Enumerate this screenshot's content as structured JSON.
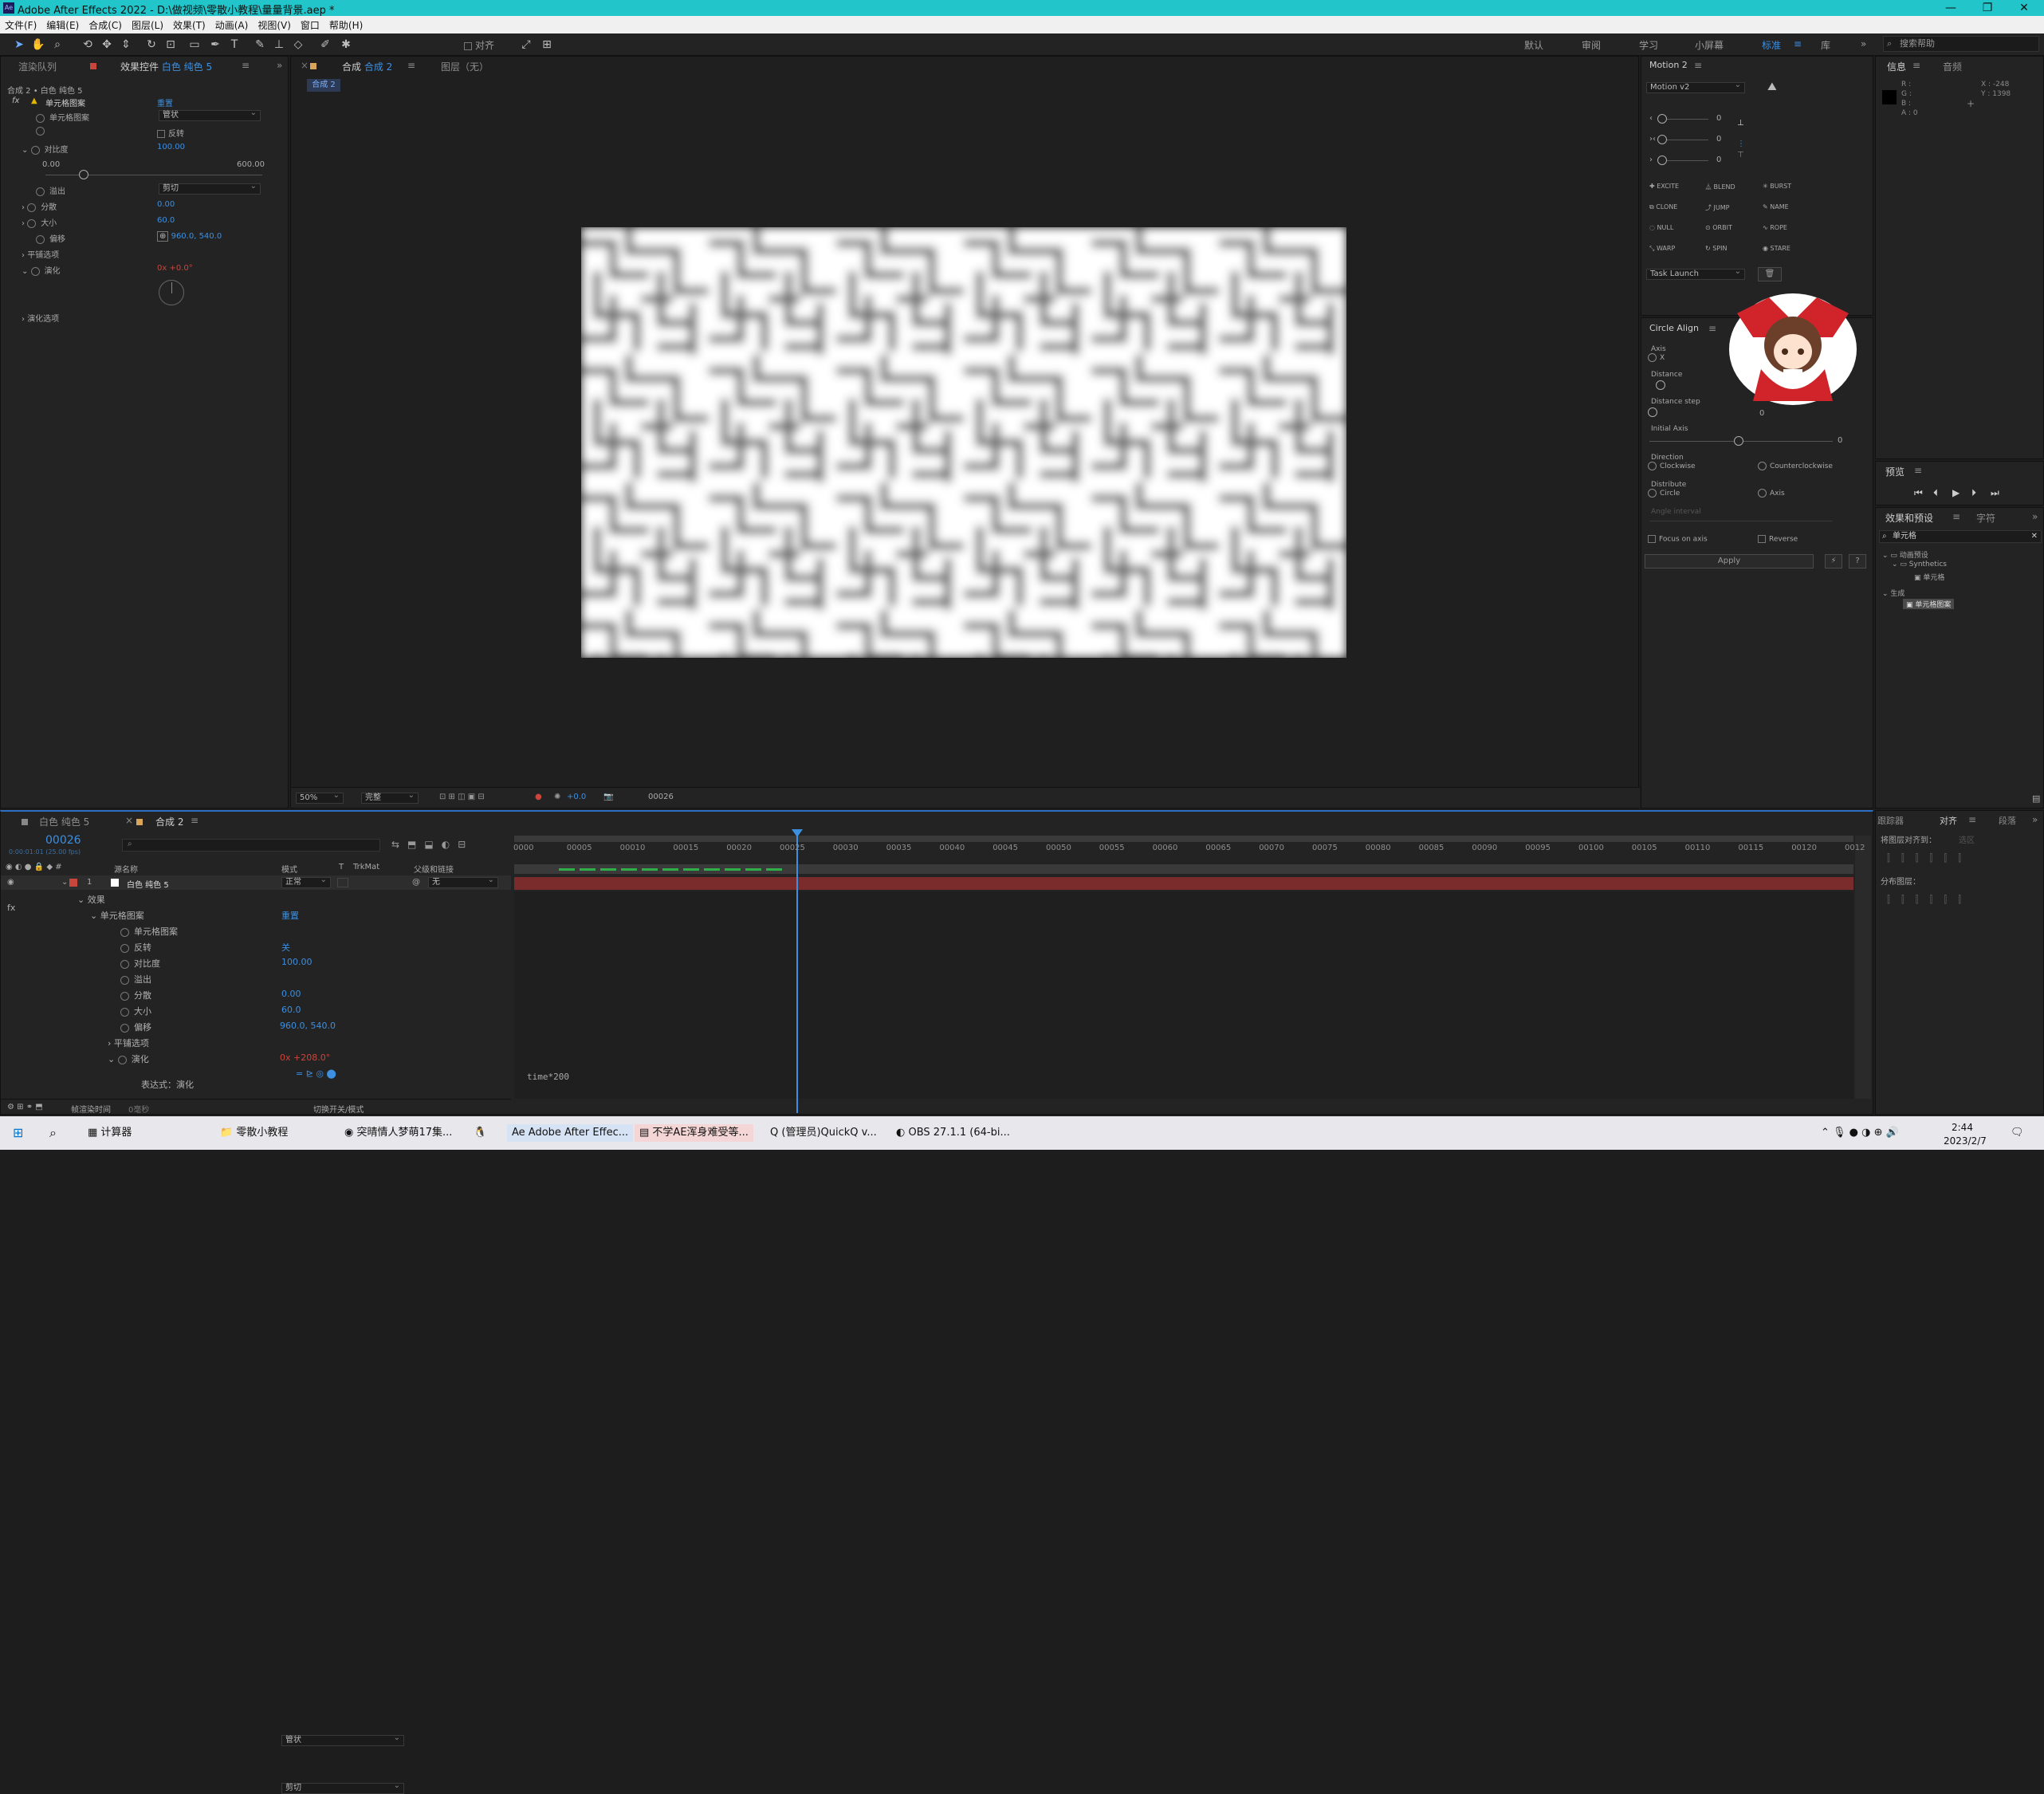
{
  "app": {
    "title": "Adobe After Effects 2022 - D:\\做视频\\零散小教程\\量量背景.aep *"
  },
  "menu": [
    "文件(F)",
    "编辑(E)",
    "合成(C)",
    "图层(L)",
    "效果(T)",
    "动画(A)",
    "视图(V)",
    "窗口",
    "帮助(H)"
  ],
  "toolbar": {
    "align_label": "对齐",
    "workspaces": [
      "默认",
      "审阅",
      "学习",
      "小屏幕",
      "标准",
      "库"
    ],
    "active_workspace": "标准",
    "search_placeholder": "搜索帮助"
  },
  "effect_panel": {
    "tab_render": "渲染队列",
    "tab_effects": "效果控件",
    "layer": "白色 纯色 5",
    "breadcrumb": "合成 2 • 白色 纯色 5",
    "effect_name": "单元格图案",
    "reset": "重置",
    "props": [
      {
        "name": "单元格图案",
        "value": "管状"
      },
      {
        "name": "反转",
        "value": ""
      },
      {
        "name": "对比度",
        "value": "100.00"
      },
      {
        "name": "",
        "value": "0.00",
        "value2": "600.00"
      },
      {
        "name": "溢出",
        "value": "剪切"
      },
      {
        "name": "分散",
        "value": "0.00"
      },
      {
        "name": "大小",
        "value": "60.0"
      },
      {
        "name": "偏移",
        "value": "960.0, 540.0"
      },
      {
        "name": "平铺选项",
        "value": ""
      },
      {
        "name": "演化",
        "value": "0x +0.0°"
      },
      {
        "name": "演化选项",
        "value": ""
      }
    ],
    "invert_label": "反转"
  },
  "comp": {
    "tab_label": "合成",
    "comp_name": "合成 2",
    "layer_tab": "图层（无）",
    "sub_tab": "合成 2",
    "zoom": "50%",
    "quality": "完整",
    "exposure": "+0.0",
    "timecode": "00026"
  },
  "motion": {
    "title": "Motion 2",
    "preset": "Motion v2",
    "rows": [
      "0",
      "0",
      "0"
    ],
    "buttons": [
      "EXCITE",
      "BLEND",
      "BURST",
      "CLONE",
      "JUMP",
      "NAME",
      "NULL",
      "ORBIT",
      "ROPE",
      "WARP",
      "SPIN",
      "STARE"
    ],
    "task": "Task Launch"
  },
  "circle_align": {
    "title": "Circle Align",
    "axis": "Axis",
    "axis_x": "X",
    "distance": "Distance",
    "distance_step": "Distance step",
    "distance_step_val": "0",
    "initial_axis": "Initial Axis",
    "initial_axis_val": "0",
    "direction": "Direction",
    "clockwise": "Clockwise",
    "counterclockwise": "Counterclockwise",
    "distribute": "Distribute",
    "circle": "Circle",
    "axis_opt": "Axis",
    "angle_interval": "Angle interval",
    "focus": "Focus on axis",
    "reverse": "Reverse",
    "apply": "Apply"
  },
  "info": {
    "tab_info": "信息",
    "tab_audio": "音频",
    "r": "R :",
    "g": "G :",
    "b": "B :",
    "a": "A : 0",
    "x": "X : -248",
    "y": "Y : 1398"
  },
  "preview": {
    "title": "预览"
  },
  "effects_presets": {
    "tab": "效果和预设",
    "tab2": "字符",
    "search": "单元格",
    "tree": [
      {
        "label": "动画预设",
        "level": 0
      },
      {
        "label": "Synthetics",
        "level": 1
      },
      {
        "label": "单元格",
        "level": 2
      },
      {
        "label": "生成",
        "level": 0
      },
      {
        "label": "单元格图案",
        "level": 1
      }
    ]
  },
  "align": {
    "tab_align": "对齐",
    "tab_para": "段落",
    "tab_tracker": "跟踪器",
    "align_to": "将图层对齐到：",
    "align_to_val": "选区",
    "distribute": "分布图层："
  },
  "timeline": {
    "tabs": [
      "白色 纯色 5",
      "合成 2"
    ],
    "timecode": "00026",
    "fps": "0:00:01:01 (25.00 fps)",
    "columns": {
      "source": "源名称",
      "mode": "模式",
      "t": "T",
      "trkmat": "TrkMat",
      "parent": "父级和链接"
    },
    "layer": {
      "num": "1",
      "name": "白色 纯色 5",
      "mode": "正常",
      "parent": "无"
    },
    "rows": [
      {
        "name": "效果",
        "value": ""
      },
      {
        "name": "单元格图案",
        "value": "重置"
      },
      {
        "name": "单元格图案",
        "value": "管状"
      },
      {
        "name": "反转",
        "value": "关"
      },
      {
        "name": "对比度",
        "value": "100.00"
      },
      {
        "name": "溢出",
        "value": "剪切"
      },
      {
        "name": "分散",
        "value": "0.00"
      },
      {
        "name": "大小",
        "value": "60.0"
      },
      {
        "name": "偏移",
        "value": "960.0, 540.0"
      },
      {
        "name": "平铺选项",
        "value": ""
      },
      {
        "name": "演化",
        "value": "0x +208.0°"
      },
      {
        "name": "表达式：演化",
        "value": ""
      }
    ],
    "expression": "time*200",
    "ticks": [
      "0000",
      "00005",
      "00010",
      "00015",
      "00020",
      "00025",
      "00030",
      "00035",
      "00040",
      "00045",
      "00050",
      "00055",
      "00060",
      "00065",
      "00070",
      "00075",
      "00080",
      "00085",
      "00090",
      "00095",
      "00100",
      "00105",
      "00110",
      "00115",
      "00120",
      "0012"
    ],
    "footer_left": "帧渲染时间",
    "footer_val": "0毫秒",
    "footer_mid": "切换开关/模式"
  },
  "taskbar": {
    "apps": [
      "计算器",
      "零散小教程",
      "突晴情人梦萌17集...",
      "Adobe After Effec...",
      "不学AE浑身难受等...",
      "(管理员)QuickQ v...",
      "OBS 27.1.1 (64-bi..."
    ],
    "time": "2:44",
    "date": "2023/2/7"
  }
}
